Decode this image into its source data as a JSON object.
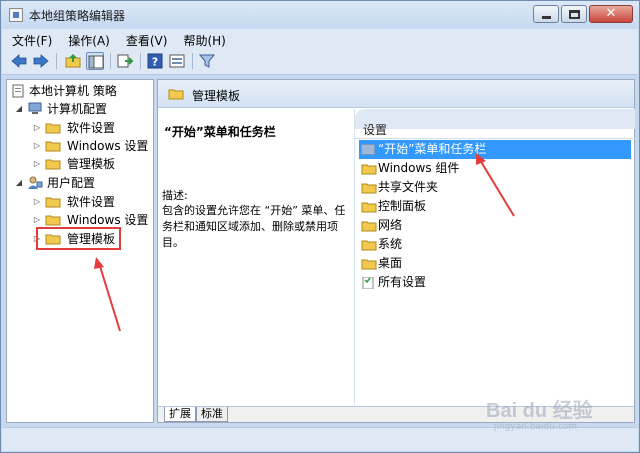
{
  "window": {
    "title": "本地组策略编辑器",
    "close_glyph": "✕"
  },
  "menu": [
    "文件(F)",
    "操作(A)",
    "查看(V)",
    "帮助(H)"
  ],
  "toolbar": {
    "icons": [
      "back-arrow-icon",
      "forward-arrow-icon",
      "up-folder-icon",
      "show-hide-tree-icon",
      "properties-icon",
      "export-icon",
      "help-icon",
      "view-icon",
      "filter-icon"
    ]
  },
  "tree": {
    "root": "本地计算机 策略",
    "computer_config": "计算机配置",
    "cc_software": "软件设置",
    "cc_windows": "Windows 设置",
    "cc_admin": "管理模板",
    "user_config": "用户配置",
    "uc_software": "软件设置",
    "uc_windows": "Windows 设置",
    "uc_admin": "管理模板"
  },
  "right": {
    "header": "管理模板",
    "desc_title": "“开始”菜单和任务栏",
    "desc_label": "描述:",
    "desc_body": "包含的设置允许您在 “开始” 菜单、任务栏和通知区域添加、删除或禁用项目。",
    "list_header": "设置",
    "items": [
      "“开始”菜单和任务栏",
      "Windows 组件",
      "共享文件夹",
      "控制面板",
      "网络",
      "系统",
      "桌面",
      "所有设置"
    ]
  },
  "tabs": [
    "扩展",
    "标准"
  ],
  "watermark": {
    "main": "Bai du 经验",
    "sub": "jingyan.baidu.com"
  },
  "colors": {
    "selection": "#3399ff",
    "annotation": "#e23c3c",
    "folder": "#f2c94c"
  }
}
